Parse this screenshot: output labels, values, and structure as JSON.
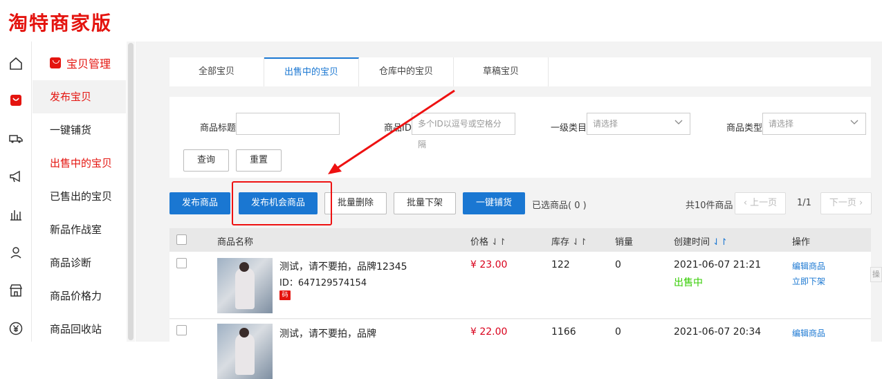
{
  "app": {
    "logo": "淘特商家版"
  },
  "icon_rail": [
    "home-icon",
    "bag-icon",
    "truck-icon",
    "megaphone-icon",
    "chart-icon",
    "user-icon",
    "store-icon",
    "yuan-icon"
  ],
  "sidebar": {
    "header": "宝贝管理",
    "items": [
      {
        "label": "发布宝贝"
      },
      {
        "label": "一键铺货"
      },
      {
        "label": "出售中的宝贝"
      },
      {
        "label": "已售出的宝贝"
      },
      {
        "label": "新品作战室"
      },
      {
        "label": "商品诊断"
      },
      {
        "label": "商品价格力"
      },
      {
        "label": "商品回收站"
      }
    ]
  },
  "tabs": [
    {
      "label": "全部宝贝"
    },
    {
      "label": "出售中的宝贝"
    },
    {
      "label": "仓库中的宝贝"
    },
    {
      "label": "草稿宝贝"
    }
  ],
  "filter": {
    "title_label": "商品标题",
    "id_label": "商品ID",
    "id_placeholder": "多个ID以逗号或空格分隔",
    "category_label": "一级类目",
    "category_placeholder": "请选择",
    "type_label": "商品类型",
    "type_placeholder": "请选择",
    "query_button": "查询",
    "reset_button": "重置"
  },
  "actions": {
    "publish": "发布商品",
    "publish_opportunity": "发布机会商品",
    "batch_delete": "批量删除",
    "batch_delist": "批量下架",
    "one_click": "一键铺货",
    "selected": "已选商品( 0 )",
    "total": "共10件商品",
    "prev": "上一页",
    "page": "1/1",
    "next": "下一页"
  },
  "table": {
    "headers": {
      "name": "商品名称",
      "price": "价格",
      "stock": "库存",
      "sales": "销量",
      "created": "创建时间",
      "ops": "操作"
    },
    "rows": [
      {
        "title": "测试，请不要拍，品牌12345",
        "id": "ID：647129574154",
        "badge": "码",
        "price": "¥ 23.00",
        "stock": "122",
        "sales": "0",
        "created": "2021-06-07 21:21",
        "status": "出售中",
        "op1": "编辑商品",
        "op2": "立即下架"
      },
      {
        "title": "测试，请不要拍，品牌",
        "price": "¥ 22.00",
        "stock": "1166",
        "sales": "0",
        "created": "2021-06-07 20:34",
        "op1": "编辑商品"
      }
    ]
  },
  "edge_tag": "操",
  "colors": {
    "brand_red": "#e4140f",
    "primary_blue": "#1a77d2",
    "status_green": "#33cc00",
    "annotation_red": "#e11111"
  }
}
